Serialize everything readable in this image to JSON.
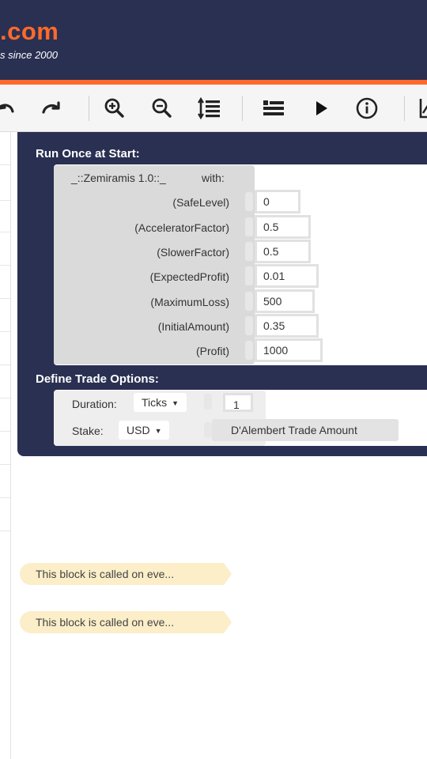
{
  "header": {
    "logo_text": ".com",
    "tagline": "s since 2000"
  },
  "toolbar": {
    "buttons": [
      {
        "name": "undo-button",
        "icon": "undo-icon"
      },
      {
        "name": "redo-button",
        "icon": "redo-icon"
      },
      {
        "name": "zoom-in-button",
        "icon": "zoom-in-icon"
      },
      {
        "name": "zoom-out-button",
        "icon": "zoom-out-icon"
      },
      {
        "name": "sort-blocks-button",
        "icon": "sort-lines-icon"
      },
      {
        "name": "toggle-list-button",
        "icon": "list-icon"
      },
      {
        "name": "run-button",
        "icon": "play-icon"
      },
      {
        "name": "info-button",
        "icon": "info-icon"
      },
      {
        "name": "chart-button",
        "icon": "chart-icon"
      }
    ]
  },
  "colors": {
    "header_bg": "#2a3052",
    "accent": "#ff6a2b",
    "block_bg": "#2a3052",
    "comment_bg": "#fbeec8"
  },
  "run_once": {
    "label": "Run Once at Start:",
    "function_name": "_::Zemiramis 1.0::_",
    "with_label": "with:",
    "params": [
      {
        "label": "(SafeLevel)",
        "value": "0"
      },
      {
        "label": "(AcceleratorFactor)",
        "value": "0.5"
      },
      {
        "label": "(SlowerFactor)",
        "value": "0.5"
      },
      {
        "label": "(ExpectedProfit)",
        "value": "0.01"
      },
      {
        "label": "(MaximumLoss)",
        "value": "500"
      },
      {
        "label": "(InitialAmount)",
        "value": "0.35"
      },
      {
        "label": "(Profit)",
        "value": "1000"
      }
    ]
  },
  "trade_options": {
    "label": "Define Trade Options:",
    "duration_label": "Duration:",
    "duration_unit": "Ticks",
    "duration_value": "1",
    "stake_label": "Stake:",
    "stake_currency": "USD",
    "stake_amount": "D'Alembert Trade Amount"
  },
  "comments": [
    {
      "text": "This block is called on eve..."
    },
    {
      "text": "This block is called on eve..."
    }
  ]
}
